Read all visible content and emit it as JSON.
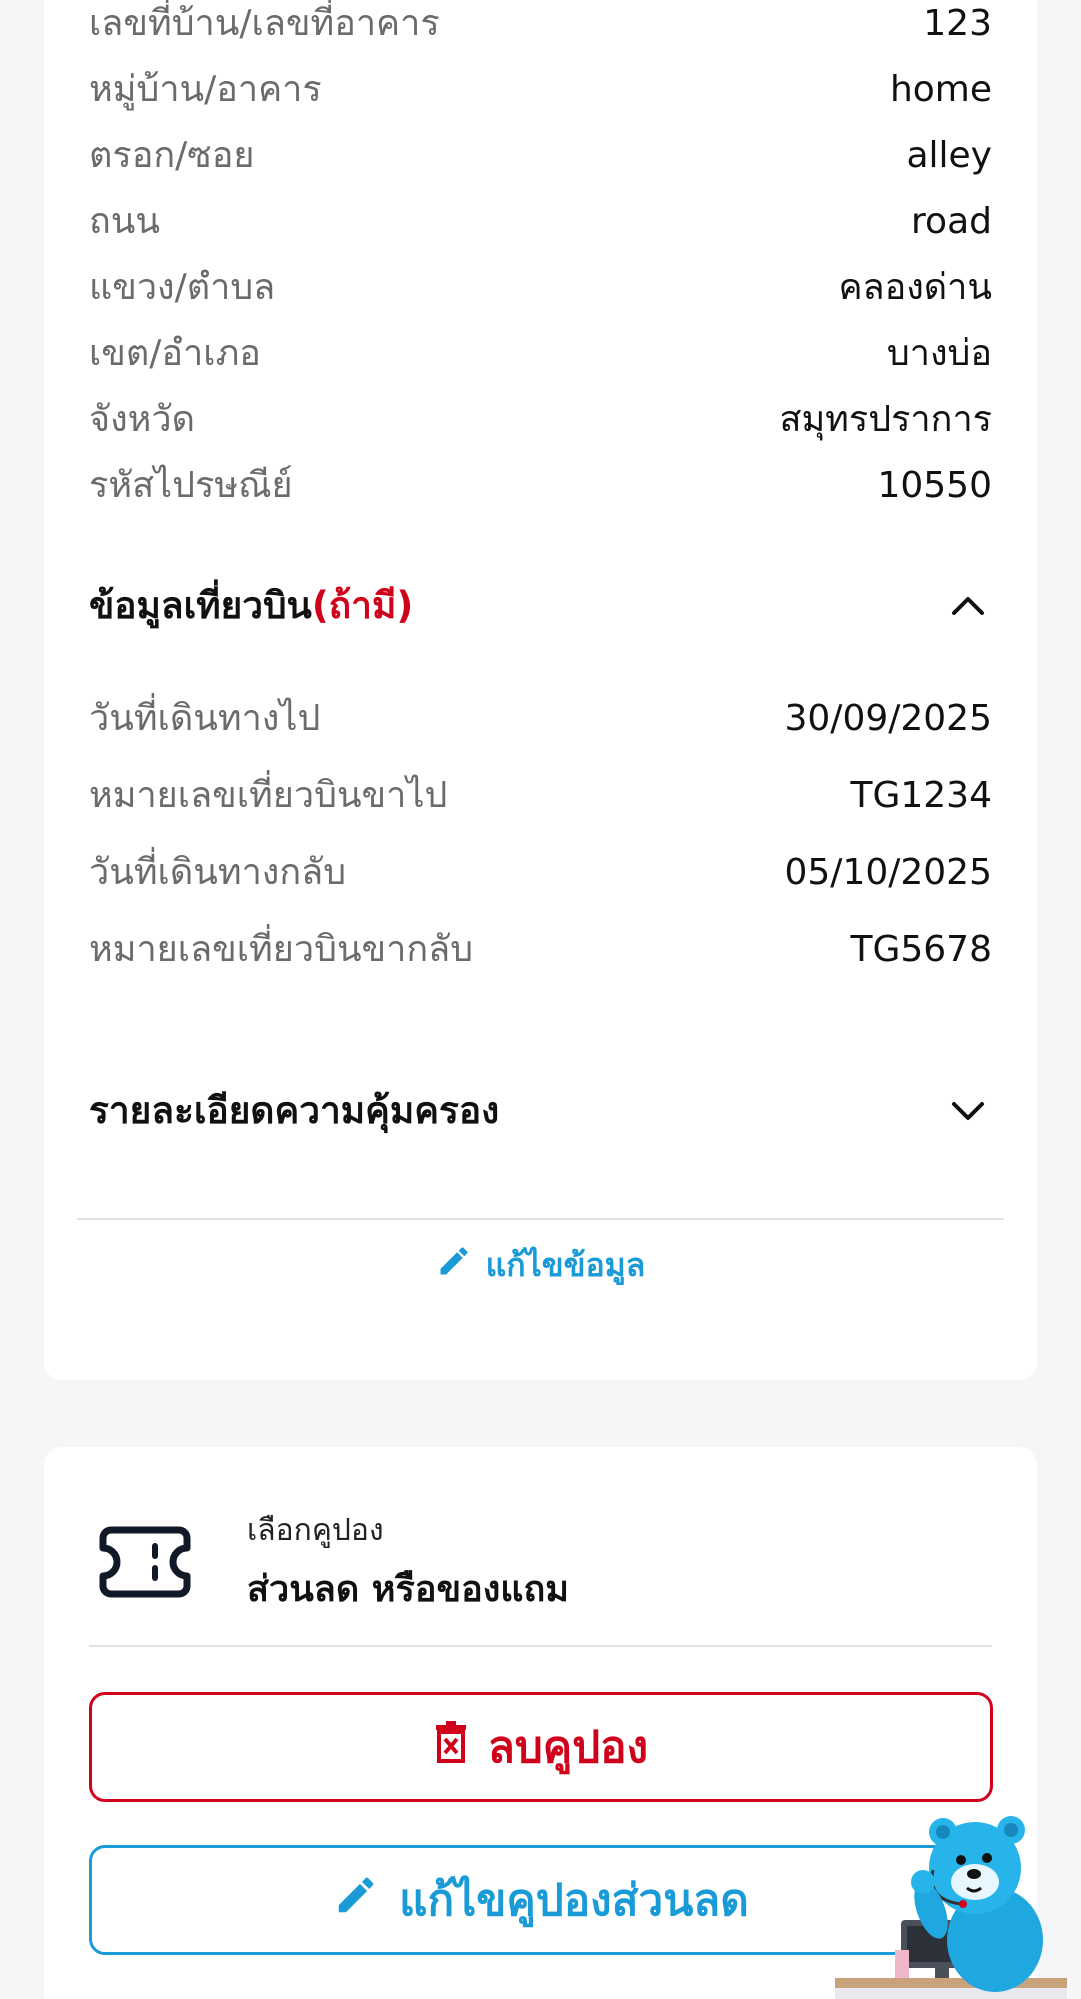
{
  "address": {
    "rows": [
      {
        "label": "เลขที่บ้าน/เลขที่อาคาร",
        "value": "123"
      },
      {
        "label": "หมู่บ้าน/อาคาร",
        "value": "home"
      },
      {
        "label": "ตรอก/ซอย",
        "value": "alley"
      },
      {
        "label": "ถนน",
        "value": "road"
      },
      {
        "label": "แขวง/ตำบล",
        "value": "คลองด่าน"
      },
      {
        "label": "เขต/อำเภอ",
        "value": "บางบ่อ"
      },
      {
        "label": "จังหวัด",
        "value": "สมุทรปราการ"
      },
      {
        "label": "รหัสไปรษณีย์",
        "value": "10550"
      }
    ]
  },
  "flight": {
    "title": "ข้อมูลเที่ยวบิน",
    "optional": "(ถ้ามี)",
    "rows": [
      {
        "label": "วันที่เดินทางไป",
        "value": "30/09/2025"
      },
      {
        "label": "หมายเลขเที่ยวบินขาไป",
        "value": "TG1234"
      },
      {
        "label": "วันที่เดินทางกลับ",
        "value": "05/10/2025"
      },
      {
        "label": "หมายเลขเที่ยวบินขากลับ",
        "value": "TG5678"
      }
    ]
  },
  "coverage": {
    "title": "รายละเอียดความคุ้มครอง"
  },
  "edit_info_label": "แก้ไขข้อมูล",
  "coupon": {
    "subtitle": "เลือกคูปอง",
    "title": "ส่วนลด หรือของแถม",
    "remove_label": "ลบคูปอง",
    "edit_label": "แก้ไขคูปองส่วนลด"
  },
  "colors": {
    "accent": "#1a9bd7",
    "danger": "#d0021b",
    "background": "#f5f6f8"
  },
  "icons": {
    "flight_toggle": "chevron-up-icon",
    "coverage_toggle": "chevron-down-icon",
    "edit": "pencil-icon",
    "coupon": "ticket-icon",
    "remove": "trash-icon",
    "mascot": "bear-mascot"
  }
}
